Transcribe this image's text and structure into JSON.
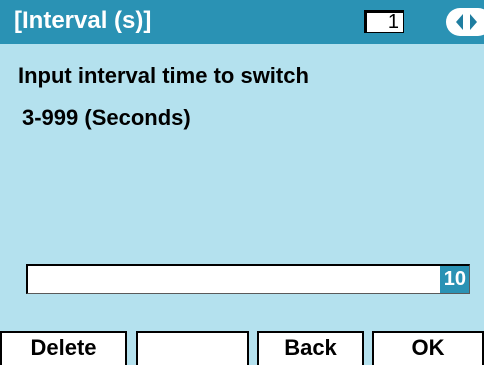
{
  "title_bar": {
    "title": "[Interval (s)]",
    "page_indicator": "1",
    "nav_icon": "left-right-arrows-icon"
  },
  "content": {
    "prompt": "Input interval time to switch",
    "range_hint": "3-999 (Seconds)"
  },
  "input": {
    "value": "10"
  },
  "softkeys": [
    {
      "label": "Delete"
    },
    {
      "label": ""
    },
    {
      "label": "Back"
    },
    {
      "label": "OK"
    }
  ],
  "colors": {
    "background": "#b4e1ee",
    "title_bar": "#2a92b4",
    "highlight": "#2a92b4",
    "text": "#000000"
  }
}
